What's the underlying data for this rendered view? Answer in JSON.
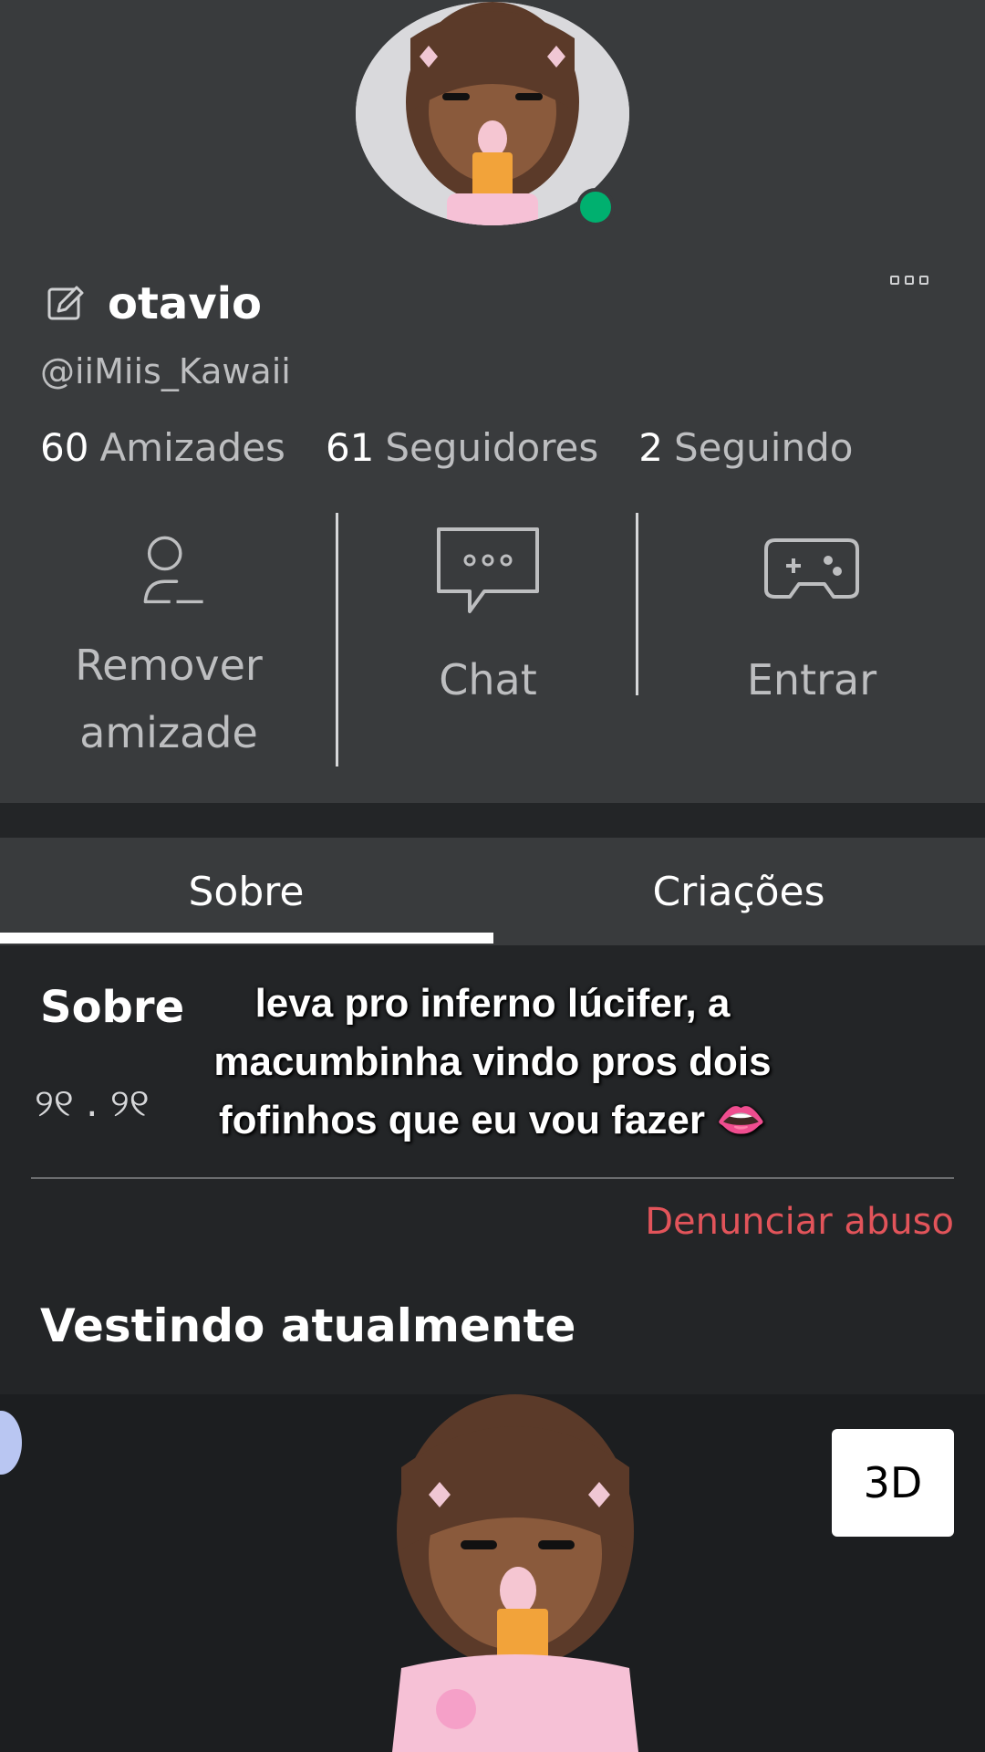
{
  "profile": {
    "display_name": "otavio",
    "username": "@iiMiis_Kawaii",
    "online_color": "#00b06f",
    "stats": [
      {
        "number": "60",
        "label": "Amizades"
      },
      {
        "number": "61",
        "label": "Seguidores"
      },
      {
        "number": "2",
        "label": "Seguindo"
      }
    ]
  },
  "actions": [
    {
      "label": "Remover amizade",
      "icon": "remove-friend-icon"
    },
    {
      "label": "Chat",
      "icon": "chat-icon"
    },
    {
      "label": "Entrar",
      "icon": "gamepad-icon"
    }
  ],
  "tabs": [
    {
      "label": "Sobre",
      "selected": true
    },
    {
      "label": "Criações",
      "selected": false
    }
  ],
  "about": {
    "title": "Sobre",
    "text": "୨୧ . ୨୧",
    "report_label": "Denunciar abuso"
  },
  "wearing": {
    "title": "Vestindo atualmente",
    "view_3d_label": "3D"
  },
  "caption": {
    "text": "leva pro inferno lúcifer, a macumbinha vindo pros dois fofinhos que eu vou fazer 👄"
  }
}
